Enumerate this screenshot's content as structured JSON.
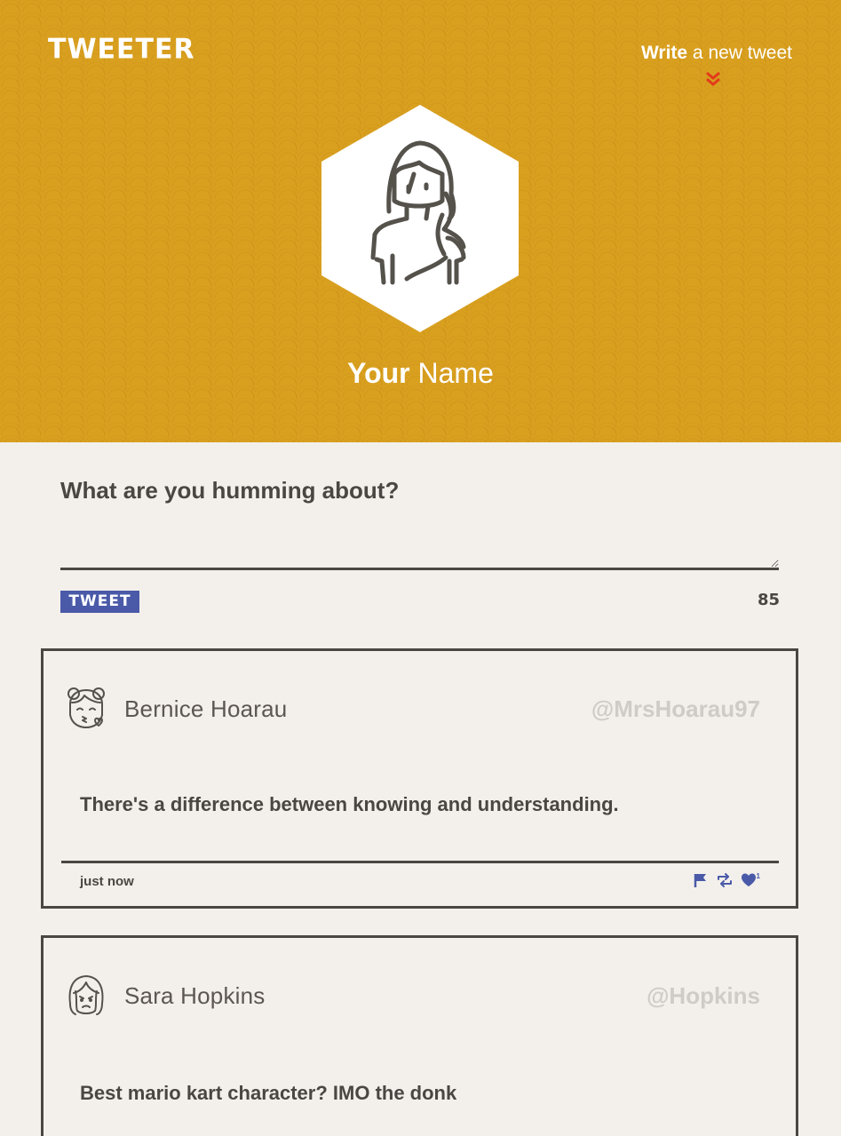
{
  "app": {
    "brand": "TWEETER"
  },
  "header": {
    "compose_bold": "Write",
    "compose_rest": " a new tweet",
    "profile_first": "Your",
    "profile_last": " Name"
  },
  "composer": {
    "prompt": "What are you humming about?",
    "value": "",
    "button_label": "TWEET",
    "char_count": "85"
  },
  "tweets": [
    {
      "name": "Bernice Hoarau",
      "handle": "@MrsHoarau97",
      "body": "There's a difference between knowing and understanding.",
      "time": "just now",
      "likes": "1",
      "avatar_icon": "kissing-girl-avatar-icon"
    },
    {
      "name": "Sara Hopkins",
      "handle": "@Hopkins",
      "body": "Best mario kart character? IMO the donk",
      "avatar_icon": "frowning-girl-avatar-icon"
    }
  ],
  "colors": {
    "header_bg": "#d9a020",
    "page_bg": "#f3f0ec",
    "text_dark": "#4a4642",
    "accent_blue": "#4a5aa8",
    "chevron_red": "#e23b1a",
    "handle_grey": "#cfcbc6"
  }
}
